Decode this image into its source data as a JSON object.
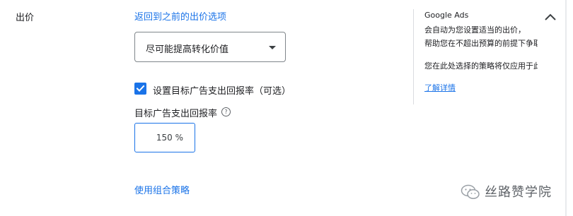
{
  "bidding": {
    "section_title": "出价",
    "back_link": "返回到之前的出价选项",
    "strategy": {
      "selected": "尽可能提高转化价值"
    },
    "target_roas_checkbox": {
      "checked": true,
      "label": "设置目标广告支出回报率（可选）"
    },
    "target_roas": {
      "label": "目标广告支出回报率",
      "help_icon_glyph": "?",
      "value": "150",
      "unit": "%"
    },
    "portfolio_link": "使用组合策略"
  },
  "info_panel": {
    "title": "Google Ads",
    "line1": "会自动为您设置适当的出价，",
    "line2": "帮助您在不超出预算的前提下争取",
    "line3": "您在此处选择的策略将仅应用于此",
    "learn_more": "了解详情"
  },
  "watermark": {
    "text": "丝路赞学院",
    "icon": "wechat-icon"
  },
  "colors": {
    "accent": "#1a73e8",
    "text": "#202124",
    "border": "#80868b"
  }
}
